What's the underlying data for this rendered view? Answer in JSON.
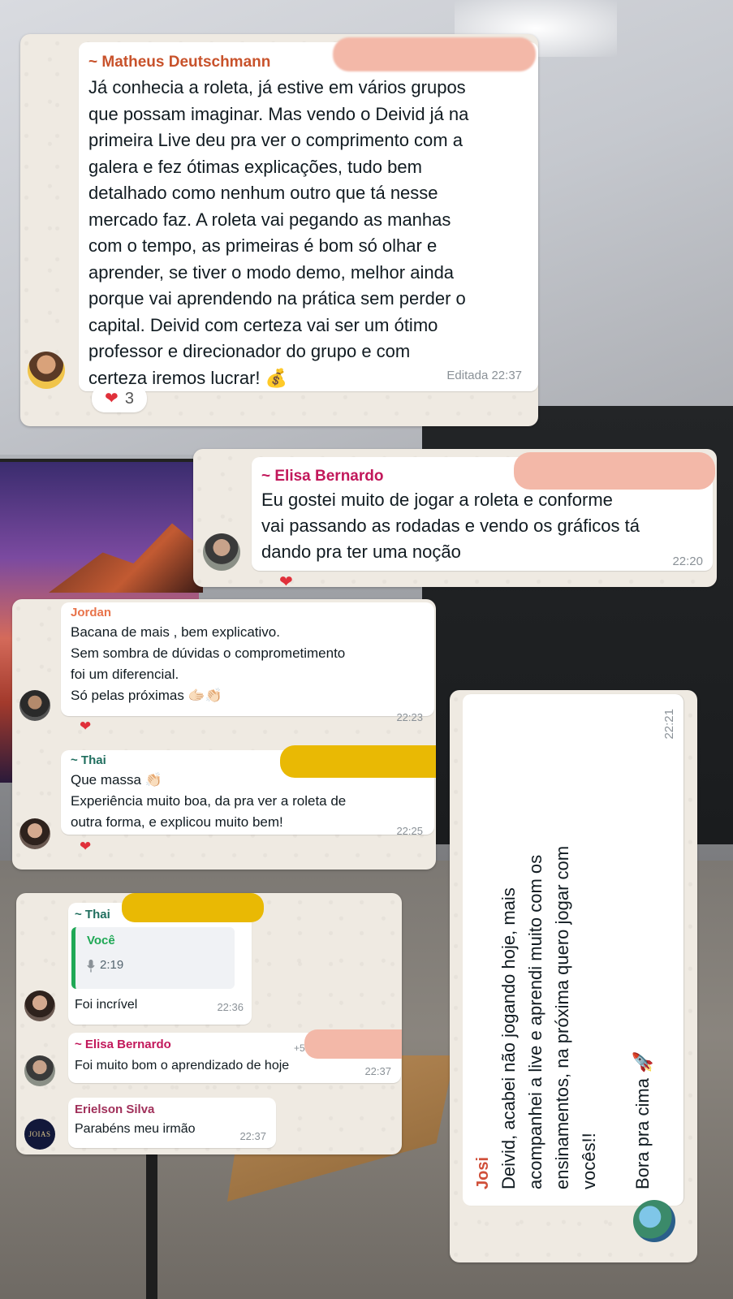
{
  "messages": {
    "m1": {
      "sender": "~ Matheus Deutschmann",
      "sender_color": "#c8522b",
      "lines": [
        "Já conhecia a roleta, já estive em vários grupos",
        "que possam imaginar. Mas vendo o Deivid já na",
        "primeira Live deu pra ver o comprimento com a",
        "galera e fez ótimas explicações, tudo bem",
        "detalhado como nenhum outro que tá nesse",
        "mercado faz. A roleta vai pegando as manhas",
        "com o tempo, as primeiras é bom só olhar e",
        "aprender, se tiver o modo demo, melhor ainda",
        "porque vai aprendendo na prática sem perder o",
        "capital. Deivid com certeza vai ser um ótimo",
        "professor e direcionador do grupo e com",
        "certeza iremos lucrar! 💰"
      ],
      "time": "Editada 22:37",
      "reaction_emoji": "❤",
      "reaction_count": "3"
    },
    "m2": {
      "sender": "~ Elisa Bernardo",
      "sender_color": "#c2185b",
      "lines": [
        "Eu gostei muito de jogar a roleta e conforme",
        "vai passando as rodadas e vendo os gráficos tá",
        "dando pra ter uma noção"
      ],
      "time": "22:20",
      "reaction_emoji": "❤"
    },
    "m3": {
      "sender": "Jordan",
      "sender_color": "#e8734a",
      "lines": [
        "Bacana de mais , bem explicativo.",
        "Sem sombra de dúvidas o comprometimento",
        "foi um diferencial.",
        "Só pelas próximas 🫱🏻👏🏻"
      ],
      "time": "22:23",
      "reaction_emoji": "❤"
    },
    "m4": {
      "sender": "~ Thai",
      "sender_color": "#1f6e5e",
      "lines": [
        "Que massa 👏🏻",
        "Experiência muito boa, da pra ver a roleta de",
        "outra forma, e explicou muito bem!"
      ],
      "time": "22:25",
      "reaction_emoji": "❤"
    },
    "m5": {
      "sender": "~ Thai",
      "sender_color": "#1f6e5e",
      "quote_author": "Você",
      "quote_author_color": "#1fa855",
      "quote_audio": "2:19",
      "text": "Foi incrível",
      "time": "22:36"
    },
    "m6": {
      "sender": "~ Elisa Bernardo",
      "sender_color": "#c2185b",
      "phone_prefix": "+5",
      "text": "Foi muito bom o aprendizado de hoje",
      "time": "22:37"
    },
    "m7": {
      "sender": "Erielson Silva",
      "sender_color": "#a0305a",
      "avatar_text": "JOIAS",
      "text": "Parabéns meu irmão",
      "time": "22:37"
    },
    "m8": {
      "sender": "Josi",
      "sender_color": "#d0503a",
      "lines": [
        "Deivid, acabei não jogando hoje, mais",
        "acompanhei a live e aprendi muito com os",
        "ensinamentos, na próxima quero jogar com",
        "vocês!!",
        "",
        "Bora pra cima 🚀"
      ],
      "time": "22:21"
    }
  },
  "colors": {
    "chat_bg": "#efeae2",
    "bubble": "#ffffff",
    "redact_pink": "#f3b8a8",
    "redact_yellow": "#e9b904"
  },
  "icons": {
    "mic": "mic-icon",
    "heart": "heart-icon"
  }
}
